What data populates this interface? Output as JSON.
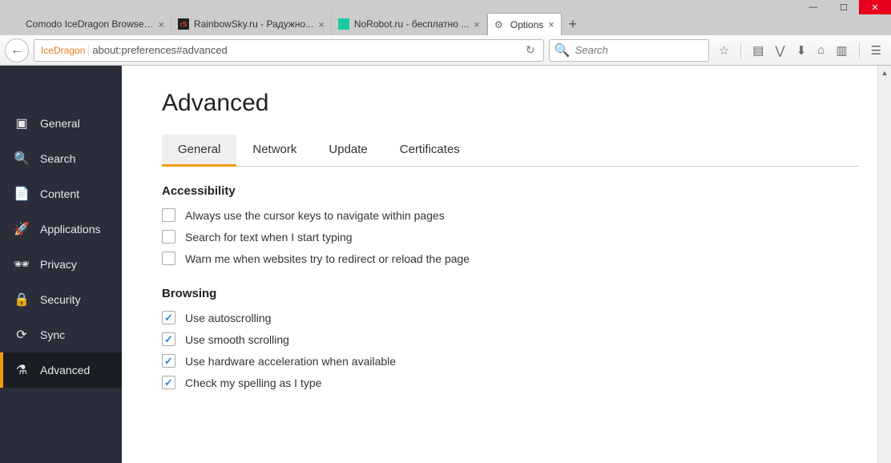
{
  "window": {
    "tabs": [
      {
        "title": "Comodo IceDragon Browser | ...",
        "favicon": "blank"
      },
      {
        "title": "RainbowSky.ru - Радужно...",
        "favicon": "rs"
      },
      {
        "title": "NoRobot.ru - бесплатно ...",
        "favicon": "teal"
      },
      {
        "title": "Options",
        "favicon": "gear",
        "active": true
      }
    ]
  },
  "toolbar": {
    "brand": "IceDragon",
    "url": "about:preferences#advanced",
    "search_placeholder": "Search"
  },
  "sidebar": {
    "items": [
      {
        "label": "General",
        "icon": "▣"
      },
      {
        "label": "Search",
        "icon": "🔍"
      },
      {
        "label": "Content",
        "icon": "📄"
      },
      {
        "label": "Applications",
        "icon": "🚀"
      },
      {
        "label": "Privacy",
        "icon": "🕶"
      },
      {
        "label": "Security",
        "icon": "🔒"
      },
      {
        "label": "Sync",
        "icon": "⟳"
      },
      {
        "label": "Advanced",
        "icon": "⚗",
        "active": true
      }
    ]
  },
  "page": {
    "title": "Advanced",
    "subtabs": [
      "General",
      "Network",
      "Update",
      "Certificates"
    ],
    "active_subtab": "General",
    "sections": {
      "accessibility": {
        "heading": "Accessibility",
        "opts": [
          {
            "label": "Always use the cursor keys to navigate within pages",
            "checked": false
          },
          {
            "label": "Search for text when I start typing",
            "checked": false
          },
          {
            "label": "Warn me when websites try to redirect or reload the page",
            "checked": false
          }
        ]
      },
      "browsing": {
        "heading": "Browsing",
        "opts": [
          {
            "label": "Use autoscrolling",
            "checked": true
          },
          {
            "label": "Use smooth scrolling",
            "checked": true
          },
          {
            "label": "Use hardware acceleration when available",
            "checked": true
          },
          {
            "label": "Check my spelling as I type",
            "checked": true
          }
        ]
      }
    }
  }
}
